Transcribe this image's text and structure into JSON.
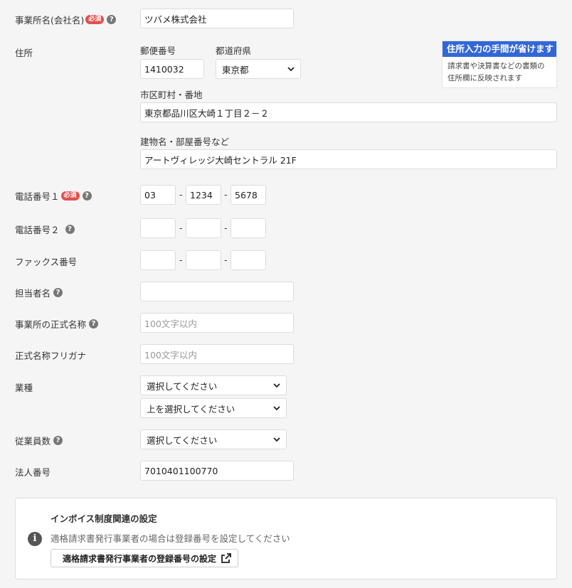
{
  "company_name": {
    "label": "事業所名(会社名)",
    "required": "必須",
    "value": "ツバメ株式会社"
  },
  "address": {
    "label": "住所",
    "postal_label": "郵便番号",
    "postal_value": "1410032",
    "pref_label": "都道府県",
    "pref_value": "東京都",
    "city_label": "市区町村・番地",
    "city_value": "東京都品川区大崎１丁目２－２",
    "building_label": "建物名・部屋番号など",
    "building_value": "アートヴィレッジ大崎セントラル 21F",
    "hint_title": "住所入力の手間が省けます",
    "hint_body": "請求書や決算書などの書類の住所欄に反映されます"
  },
  "phone1": {
    "label": "電話番号１",
    "required": "必須",
    "part1": "03",
    "part2": "1234",
    "part3": "5678"
  },
  "phone2": {
    "label": "電話番号２",
    "part1": "",
    "part2": "",
    "part3": ""
  },
  "fax": {
    "label": "ファックス番号",
    "part1": "",
    "part2": "",
    "part3": ""
  },
  "contact": {
    "label": "担当者名",
    "value": ""
  },
  "official_name": {
    "label": "事業所の正式名称",
    "placeholder": "100文字以内"
  },
  "official_kana": {
    "label": "正式名称フリガナ",
    "placeholder": "100文字以内"
  },
  "industry": {
    "label": "業種",
    "select1": "選択してください",
    "select2": "上を選択してください"
  },
  "employees": {
    "label": "従業員数",
    "select": "選択してください"
  },
  "corp_number": {
    "label": "法人番号",
    "value": "7010401100770"
  },
  "invoice": {
    "title": "インボイス制度関連の設定",
    "desc": "適格請求書発行事業者の場合は登録番号を設定してください",
    "button": "適格請求書発行事業者の登録番号の設定"
  },
  "dash": "-",
  "help_glyph": "?",
  "icons": {
    "help": "question-circle-icon",
    "info": "info-circle-icon",
    "external": "external-link-icon",
    "chevron": "chevron-down-icon"
  },
  "colors": {
    "accent": "#3367d6",
    "required": "#e0524f",
    "help": "#777777"
  }
}
